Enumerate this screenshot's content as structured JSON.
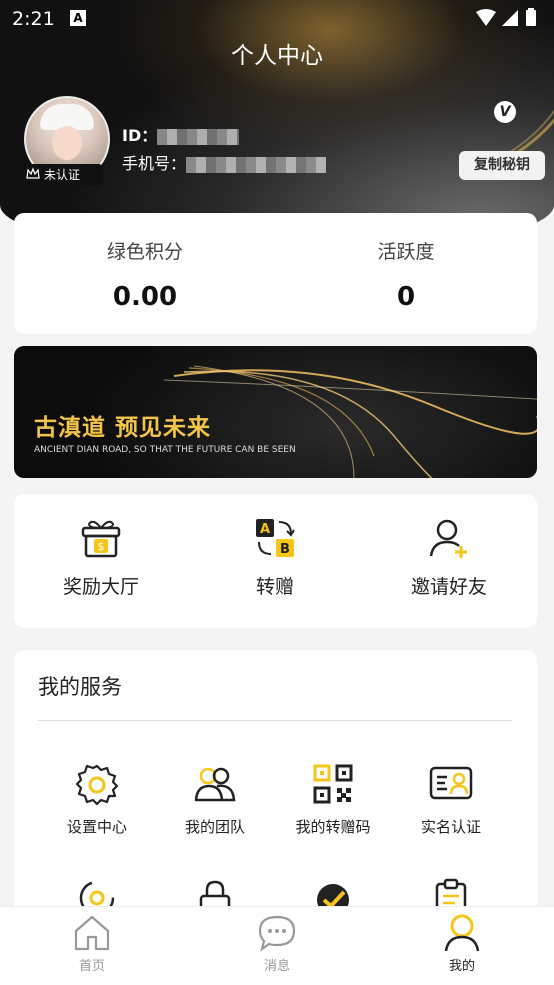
{
  "status_bar": {
    "time": "2:21"
  },
  "header": {
    "title": "个人中心"
  },
  "profile": {
    "verify_badge": "未认证",
    "id_label": "ID：",
    "phone_label": "手机号：",
    "v_badge": "V",
    "copy_key_button": "复制秘钥"
  },
  "stats": [
    {
      "label": "绿色积分",
      "value": "0.00"
    },
    {
      "label": "活跃度",
      "value": "0"
    }
  ],
  "banner": {
    "headline": "古滇道 预见未来",
    "subline": "ANCIENT DIAN ROAD, SO THAT THE FUTURE CAN BE SEEN"
  },
  "quick_actions": [
    {
      "label": "奖励大厅",
      "icon": "gift-icon"
    },
    {
      "label": "转赠",
      "icon": "transfer-ab-icon"
    },
    {
      "label": "邀请好友",
      "icon": "add-user-icon"
    }
  ],
  "services": {
    "title": "我的服务",
    "items": [
      {
        "label": "设置中心",
        "icon": "gear-icon"
      },
      {
        "label": "我的团队",
        "icon": "team-icon"
      },
      {
        "label": "我的转赠码",
        "icon": "qr-code-icon"
      },
      {
        "label": "实名认证",
        "icon": "id-card-icon"
      }
    ]
  },
  "tabbar": [
    {
      "label": "首页",
      "icon": "home-icon"
    },
    {
      "label": "消息",
      "icon": "chat-icon"
    },
    {
      "label": "我的",
      "icon": "user-icon"
    }
  ],
  "colors": {
    "accent": "#f5c518",
    "text": "#222222",
    "muted": "#999999"
  }
}
